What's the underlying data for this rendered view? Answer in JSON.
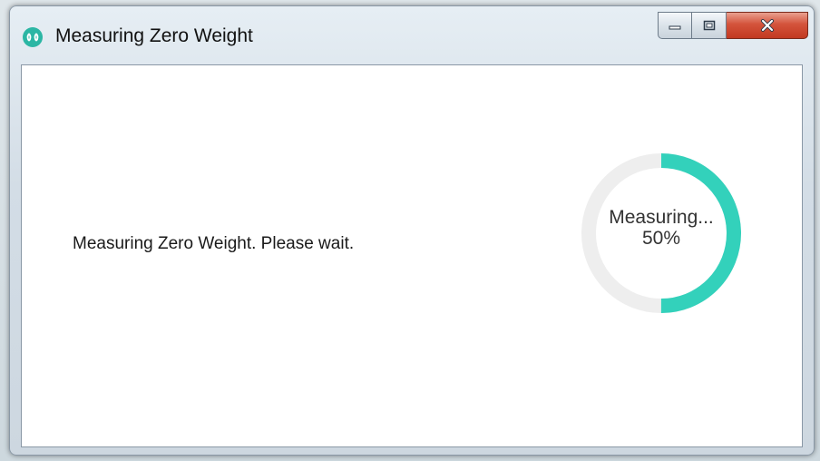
{
  "window": {
    "title": "Measuring Zero Weight",
    "icon": "maxim-logo-icon",
    "caption": {
      "minimize_icon": "minimize-icon",
      "maximize_icon": "maximize-icon",
      "close_icon": "close-icon"
    }
  },
  "content": {
    "message": "Measuring Zero Weight. Please wait."
  },
  "progress": {
    "status_text": "Measuring...",
    "percent_text": "50%",
    "value": 0.5,
    "track_color": "#eeeeee",
    "fill_color": "#33d1bb"
  }
}
